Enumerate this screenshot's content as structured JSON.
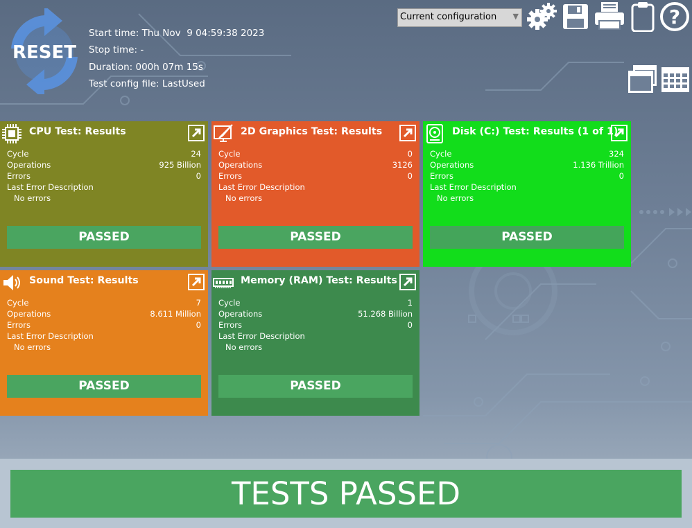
{
  "header": {
    "reset_label": "RESET",
    "start_time": "Start time: Thu Nov  9 04:59:38 2023",
    "stop_time": "Stop time: -",
    "duration": "Duration: 000h 07m 15s",
    "config_file": "Test config file: LastUsed",
    "config_select": "Current configuration"
  },
  "toolbar_icons": [
    "gears-icon",
    "save-icon",
    "printer-icon",
    "clipboard-icon",
    "help-icon",
    "windows-icon",
    "grid-icon"
  ],
  "labels": {
    "cycle": "Cycle",
    "operations": "Operations",
    "errors": "Errors",
    "last_error": "Last Error Description"
  },
  "panels": [
    {
      "title": "CPU Test: Results",
      "icon": "cpu-icon",
      "color": "#7f8524",
      "cycle": "24",
      "operations": "925 Billion",
      "errors": "0",
      "error_desc": "No errors",
      "result": "PASSED"
    },
    {
      "title": "2D Graphics Test: Results",
      "icon": "graphics-icon",
      "color": "#e25a2a",
      "cycle": "0",
      "operations": "3126",
      "errors": "0",
      "error_desc": "No errors",
      "result": "PASSED"
    },
    {
      "title": "Disk (C:) Test: Results (1 of 1)",
      "icon": "disk-icon",
      "color": "#12dd1b",
      "cycle": "324",
      "operations": "1.136 Trillion",
      "errors": "0",
      "error_desc": "No errors",
      "result": "PASSED"
    },
    {
      "title": "Sound Test: Results",
      "icon": "speaker-icon",
      "color": "#e5811d",
      "cycle": "7",
      "operations": "8.611 Million",
      "errors": "0",
      "error_desc": "No errors",
      "result": "PASSED"
    },
    {
      "title": "Memory (RAM) Test: Results",
      "icon": "ram-icon",
      "color": "#3d8a4d",
      "cycle": "1",
      "operations": "51.268 Billion",
      "errors": "0",
      "error_desc": "No errors",
      "result": "PASSED"
    }
  ],
  "summary": "TESTS PASSED",
  "colors": {
    "passed": "#4aa560",
    "background": "#6e7f96"
  }
}
